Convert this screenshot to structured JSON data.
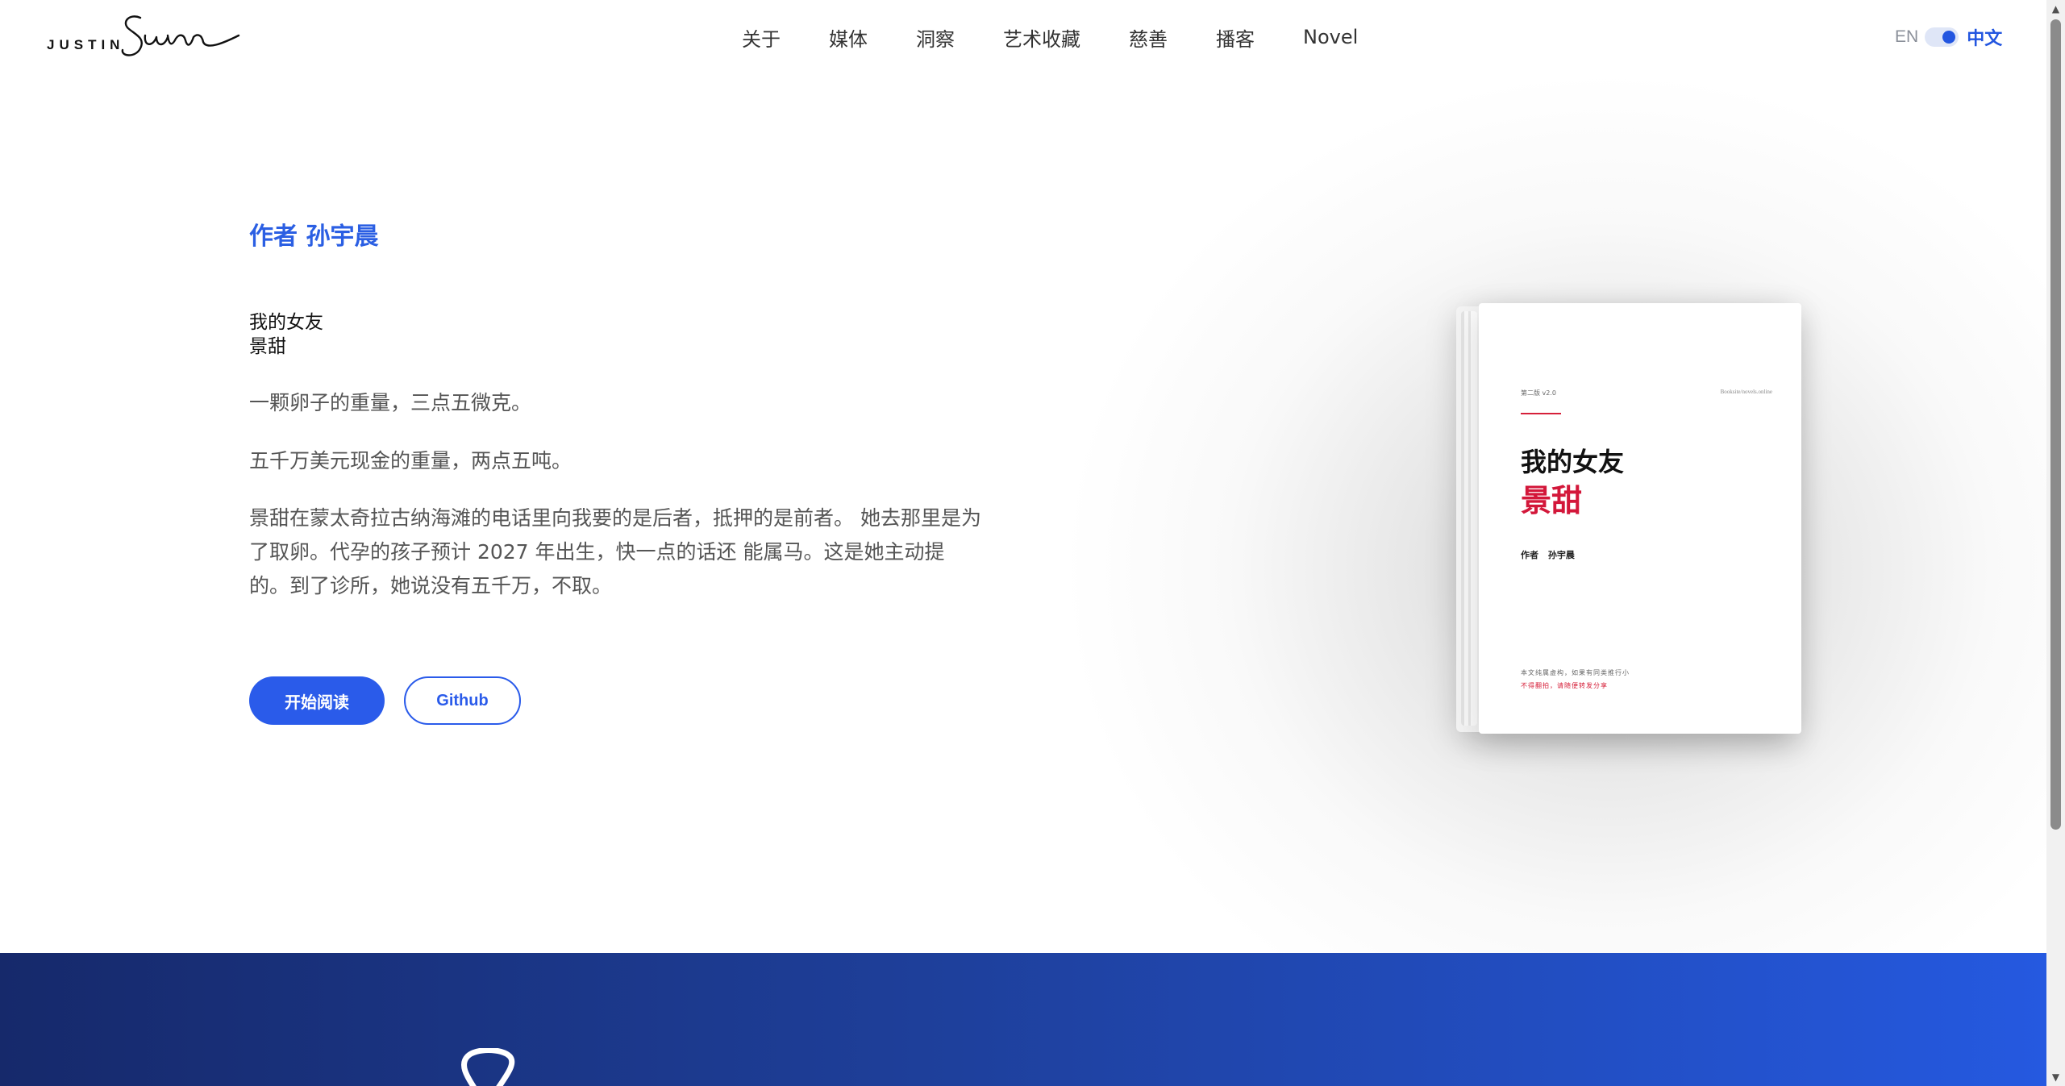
{
  "header": {
    "logo_text": "JUSTIN",
    "nav": [
      "关于",
      "媒体",
      "洞察",
      "艺术收藏",
      "慈善",
      "播客",
      "Novel"
    ],
    "lang_en": "EN",
    "lang_zh": "中文"
  },
  "hero": {
    "author": "作者 孙宇晨",
    "book_title_line1": "我的女友",
    "book_title_line2": "景甜",
    "paragraphs": [
      "一颗卵子的重量，三点五微克。",
      "五千万美元现金的重量，两点五吨。",
      "景甜在蒙太奇拉古纳海滩的电话里向我要的是后者，抵押的是前者。 她去那里是为了取卵。代孕的孩子预计 2027 年出生，快一点的话还 能属马。这是她主动提的。到了诊所，她说没有五千万，不取。"
    ],
    "read_button": "开始阅读",
    "github_button": "Github"
  },
  "book_cover": {
    "edition": "第二版 v2.0",
    "site": "Booksite/novels.online",
    "title_line1": "我的女友",
    "title_line2": "景甜",
    "author": "作者 孙宇晨",
    "note_line1": "本文纯属虚构，如果有同类推行小",
    "note_line2": "不得翻拍，请随便转发分享"
  },
  "colors": {
    "accent": "#2a5bea",
    "title_red": "#d3173a",
    "footer_dark": "#16296b",
    "footer_light": "#2559e0"
  },
  "icons": {
    "scroll_up": "▲",
    "scroll_down": "▼"
  }
}
